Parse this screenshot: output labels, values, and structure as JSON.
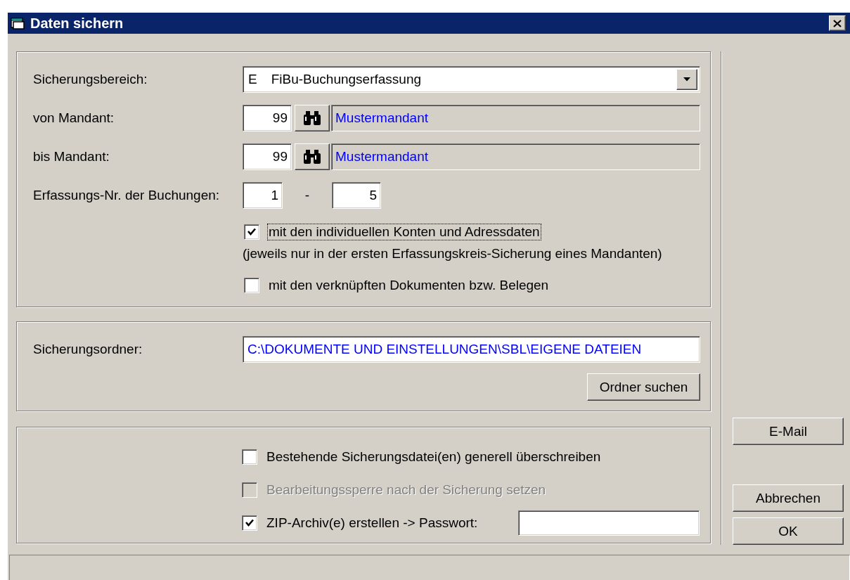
{
  "window": {
    "title": "Daten sichern"
  },
  "range": {
    "label": "Sicherungsbereich:",
    "code": "E",
    "value": "FiBu-Buchungserfassung"
  },
  "clients": [
    {
      "label": "von Mandant:",
      "number": "99",
      "name": "Mustermandant"
    },
    {
      "label": "bis Mandant:",
      "number": "99",
      "name": "Mustermandant"
    }
  ],
  "entry_numbers": {
    "label": "Erfassungs-Nr. der Buchungen:",
    "from": "1",
    "separator": "-",
    "to": "5"
  },
  "options": [
    {
      "label": "mit den individuellen Konten und Adressdaten",
      "checked": true,
      "focused": true,
      "note": "(jeweils nur in der ersten Erfassungskreis-Sicherung eines Mandanten)"
    },
    {
      "label": "mit den verknüpften Dokumenten bzw. Belegen",
      "checked": false,
      "focused": false
    }
  ],
  "folder": {
    "label": "Sicherungsordner:",
    "value": "C:\\DOKUMENTE UND EINSTELLUNGEN\\SBL\\EIGENE DATEIEN",
    "button": "Ordner suchen"
  },
  "settings": [
    {
      "kind": "plain",
      "label": "Bestehende Sicherungsdatei(en) generell überschreiben",
      "checked": false,
      "disabled": false
    },
    {
      "kind": "plain",
      "label": "Bearbeitungssperre nach der Sicherung setzen",
      "checked": false,
      "disabled": true
    },
    {
      "kind": "password",
      "label": "ZIP-Archiv(e) erstellen  -> Passwort:",
      "checked": true,
      "disabled": false
    }
  ],
  "side_buttons": [
    "E-Mail"
  ],
  "dialog_buttons": [
    "Abbrechen",
    "OK"
  ]
}
